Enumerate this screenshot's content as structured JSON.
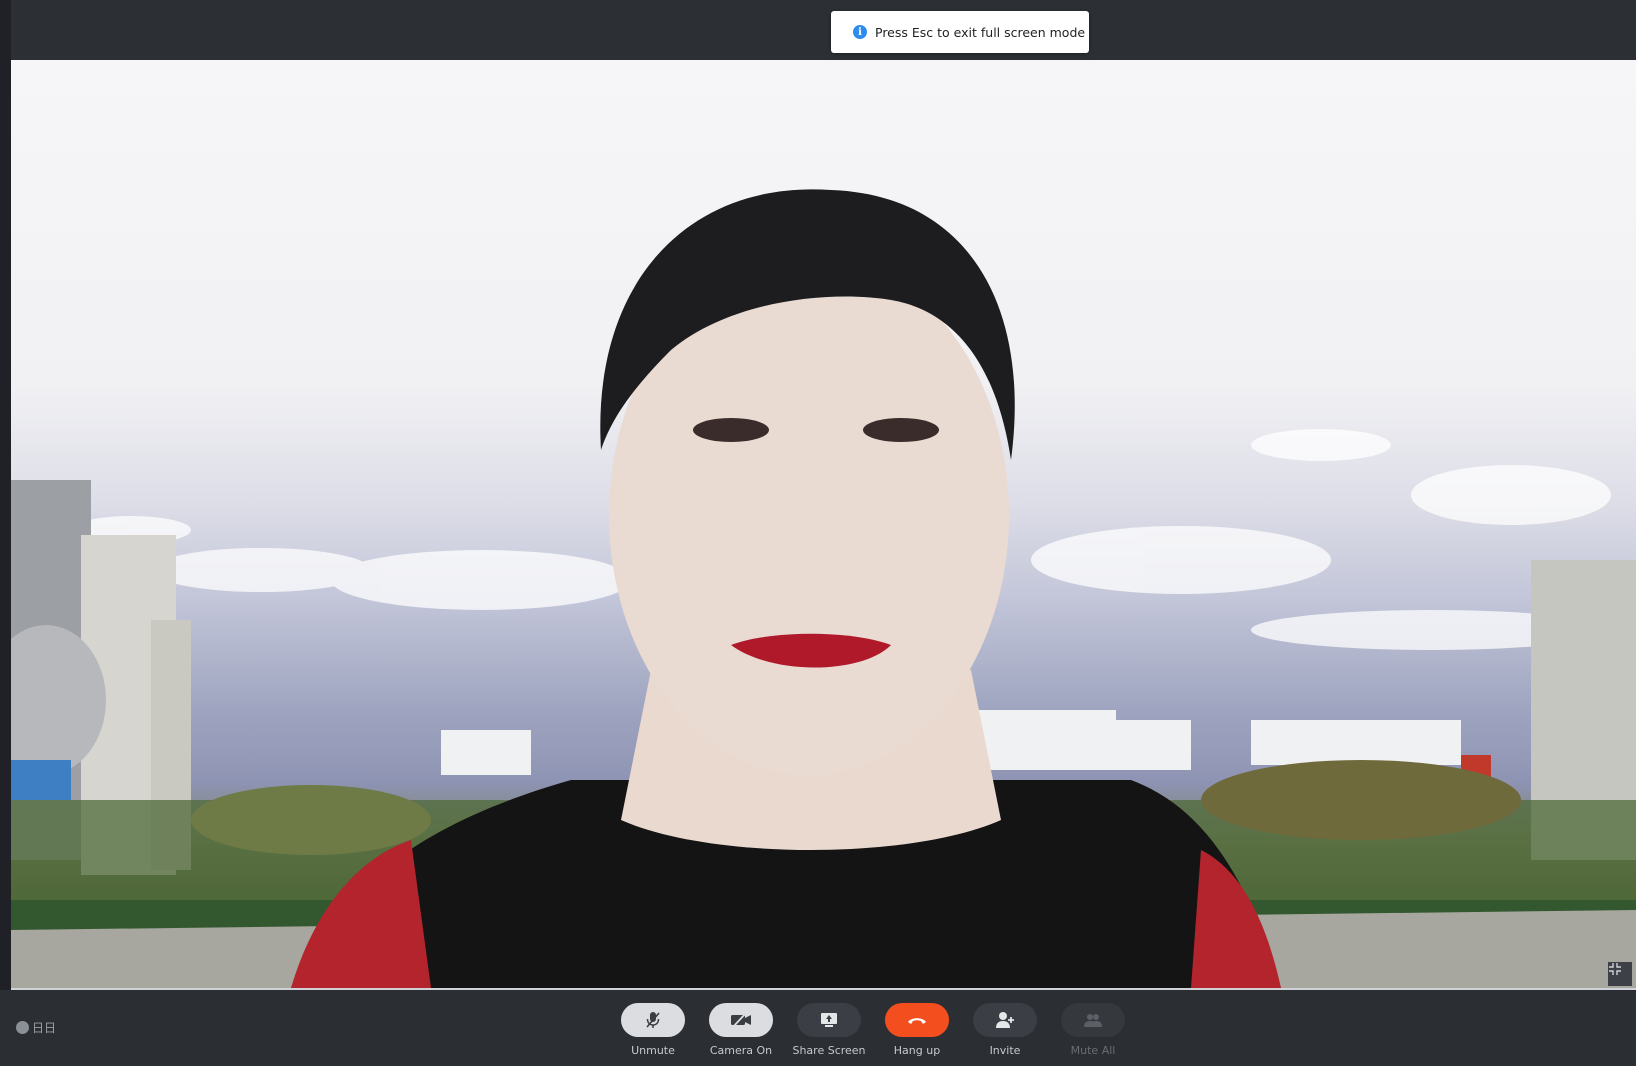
{
  "toast": {
    "icon": "info-icon",
    "text": "Press Esc to exit full screen mode"
  },
  "brand": {
    "label": "日日"
  },
  "controls": [
    {
      "id": "unmute",
      "label": "Unmute",
      "icon": "mic-off-icon"
    },
    {
      "id": "camera",
      "label": "Camera On",
      "icon": "camera-off-icon"
    },
    {
      "id": "share",
      "label": "Share Screen",
      "icon": "share-screen-icon"
    },
    {
      "id": "hangup",
      "label": "Hang up",
      "icon": "phone-hangup-icon",
      "color": "#f24e1e"
    },
    {
      "id": "invite",
      "label": "Invite",
      "icon": "add-user-icon"
    },
    {
      "id": "muteall",
      "label": "Mute All",
      "icon": "mute-all-icon",
      "disabled": true
    }
  ],
  "video": {
    "exit_fullscreen_icon": "exit-fullscreen-icon"
  }
}
